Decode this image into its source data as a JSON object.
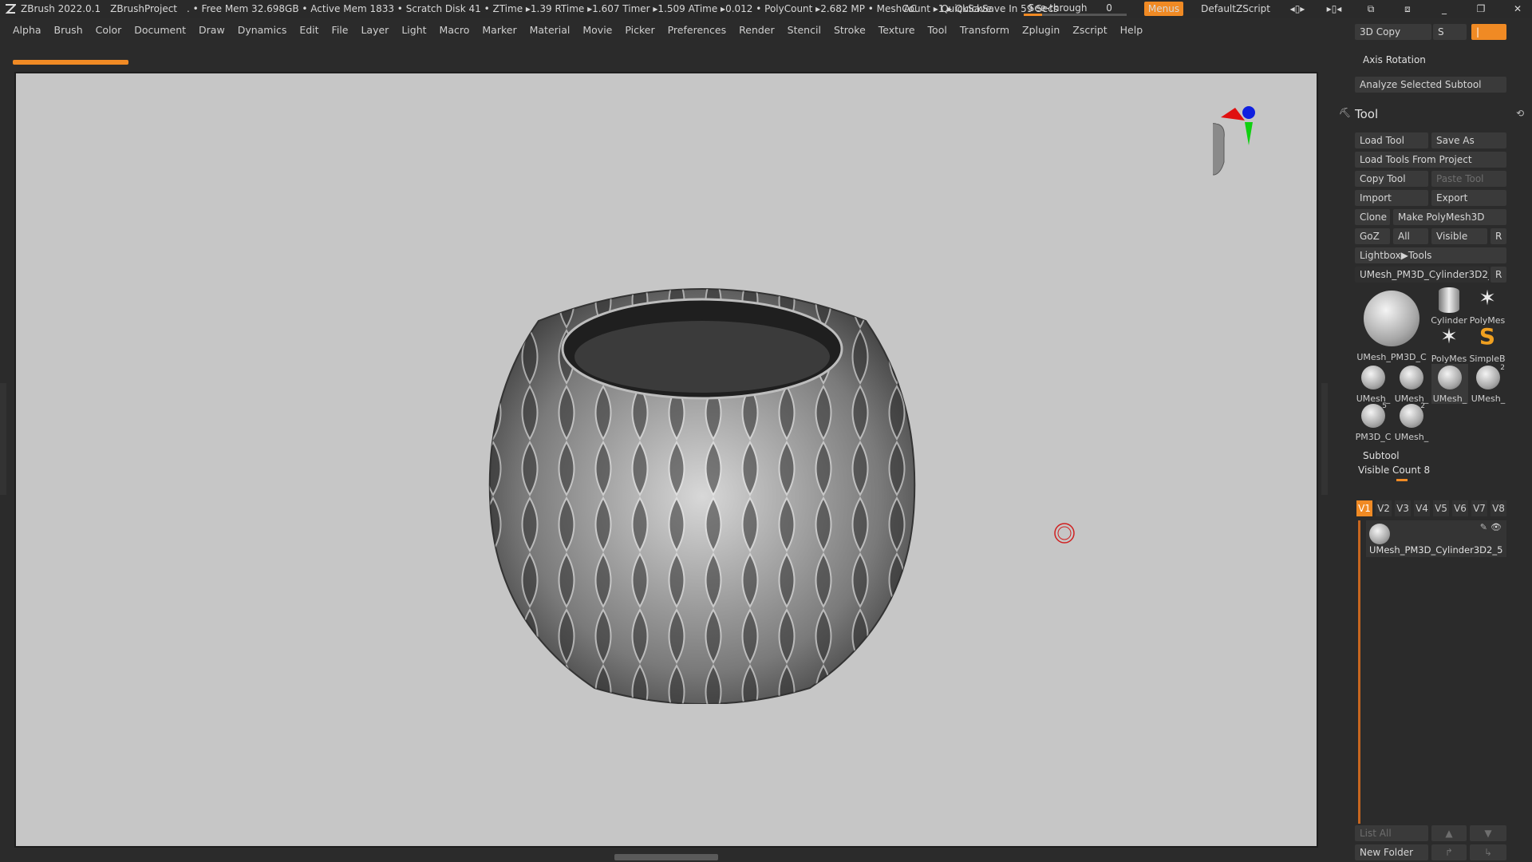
{
  "titlebar": {
    "app": "ZBrush 2022.0.1",
    "project": "ZBrushProject",
    "stats": ". • Free Mem 32.698GB • Active Mem 1833 • Scratch Disk 41 • ZTime ▸1.39 RTime ▸1.607 Timer ▸1.509 ATime ▸0.012 • PolyCount ▸2.682 MP • MeshCount ▸1 ▸ QuickSave In 59 Secs",
    "ac": "AC",
    "quicksave": "QuickSave",
    "seethrough": "See-through",
    "seethrough_value": "0",
    "seethrough_fill": 0.18,
    "menus": "Menus",
    "script": "DefaultZScript",
    "window_icons": [
      "layout-icon",
      "layout2-icon",
      "layout3-icon",
      "layout4-icon",
      "minimize-icon",
      "restore-icon",
      "close-icon"
    ]
  },
  "menubar": [
    "Alpha",
    "Brush",
    "Color",
    "Document",
    "Draw",
    "Dynamics",
    "Edit",
    "File",
    "Layer",
    "Light",
    "Macro",
    "Marker",
    "Material",
    "Movie",
    "Picker",
    "Preferences",
    "Render",
    "Stencil",
    "Stroke",
    "Texture",
    "Tool",
    "Transform",
    "Zplugin",
    "Zscript",
    "Help"
  ],
  "panel": {
    "copy3d": "3D Copy",
    "s": "S",
    "axis_rotation": "Axis Rotation",
    "analyze": "Analyze Selected Subtool",
    "tool_title": "Tool",
    "load_tool": "Load Tool",
    "save_as": "Save As",
    "load_from_project": "Load Tools From Project",
    "copy_tool": "Copy Tool",
    "paste_tool": "Paste Tool",
    "import": "Import",
    "export": "Export",
    "clone": "Clone",
    "make_polymesh": "Make PolyMesh3D",
    "goz": "GoZ",
    "all": "All",
    "visible": "Visible",
    "r": "R",
    "lightbox": "Lightbox▶Tools",
    "current_tool": "UMesh_PM3D_Cylinder3D2_5",
    "thumbs": [
      {
        "label": "UMesh_PM3D_C",
        "icon": "umesh-icon"
      },
      {
        "label": "Cylinder",
        "icon": "cylinder-icon"
      },
      {
        "label": "PolyMes",
        "icon": "star-icon"
      },
      {
        "label": "PolyMes",
        "icon": "star-icon"
      },
      {
        "label": "SimpleB",
        "icon": "simplebrush-icon"
      },
      {
        "label": "UMesh_",
        "icon": "umesh-icon"
      },
      {
        "label": "UMesh_",
        "icon": "umesh-icon"
      },
      {
        "label": "UMesh_",
        "icon": "umesh-icon"
      },
      {
        "label": "UMesh_",
        "icon": "umesh-icon"
      },
      {
        "label": "PM3D_C",
        "icon": "umesh-icon"
      },
      {
        "label": "UMesh_",
        "icon": "umesh-icon"
      }
    ],
    "thumb_badges": [
      "2",
      "5",
      "2"
    ],
    "subtool_title": "Subtool",
    "visible_count": "Visible Count",
    "visible_count_value": "8",
    "vtabs": [
      "V1",
      "V2",
      "V3",
      "V4",
      "V5",
      "V6",
      "V7",
      "V8"
    ],
    "subtool_name": "UMesh_PM3D_Cylinder3D2_5",
    "list_all": "List All",
    "new_folder": "New Folder"
  },
  "colors": {
    "accent": "#f08a24",
    "canvas": "#c6c6c6",
    "panel": "#2b2b2b"
  }
}
